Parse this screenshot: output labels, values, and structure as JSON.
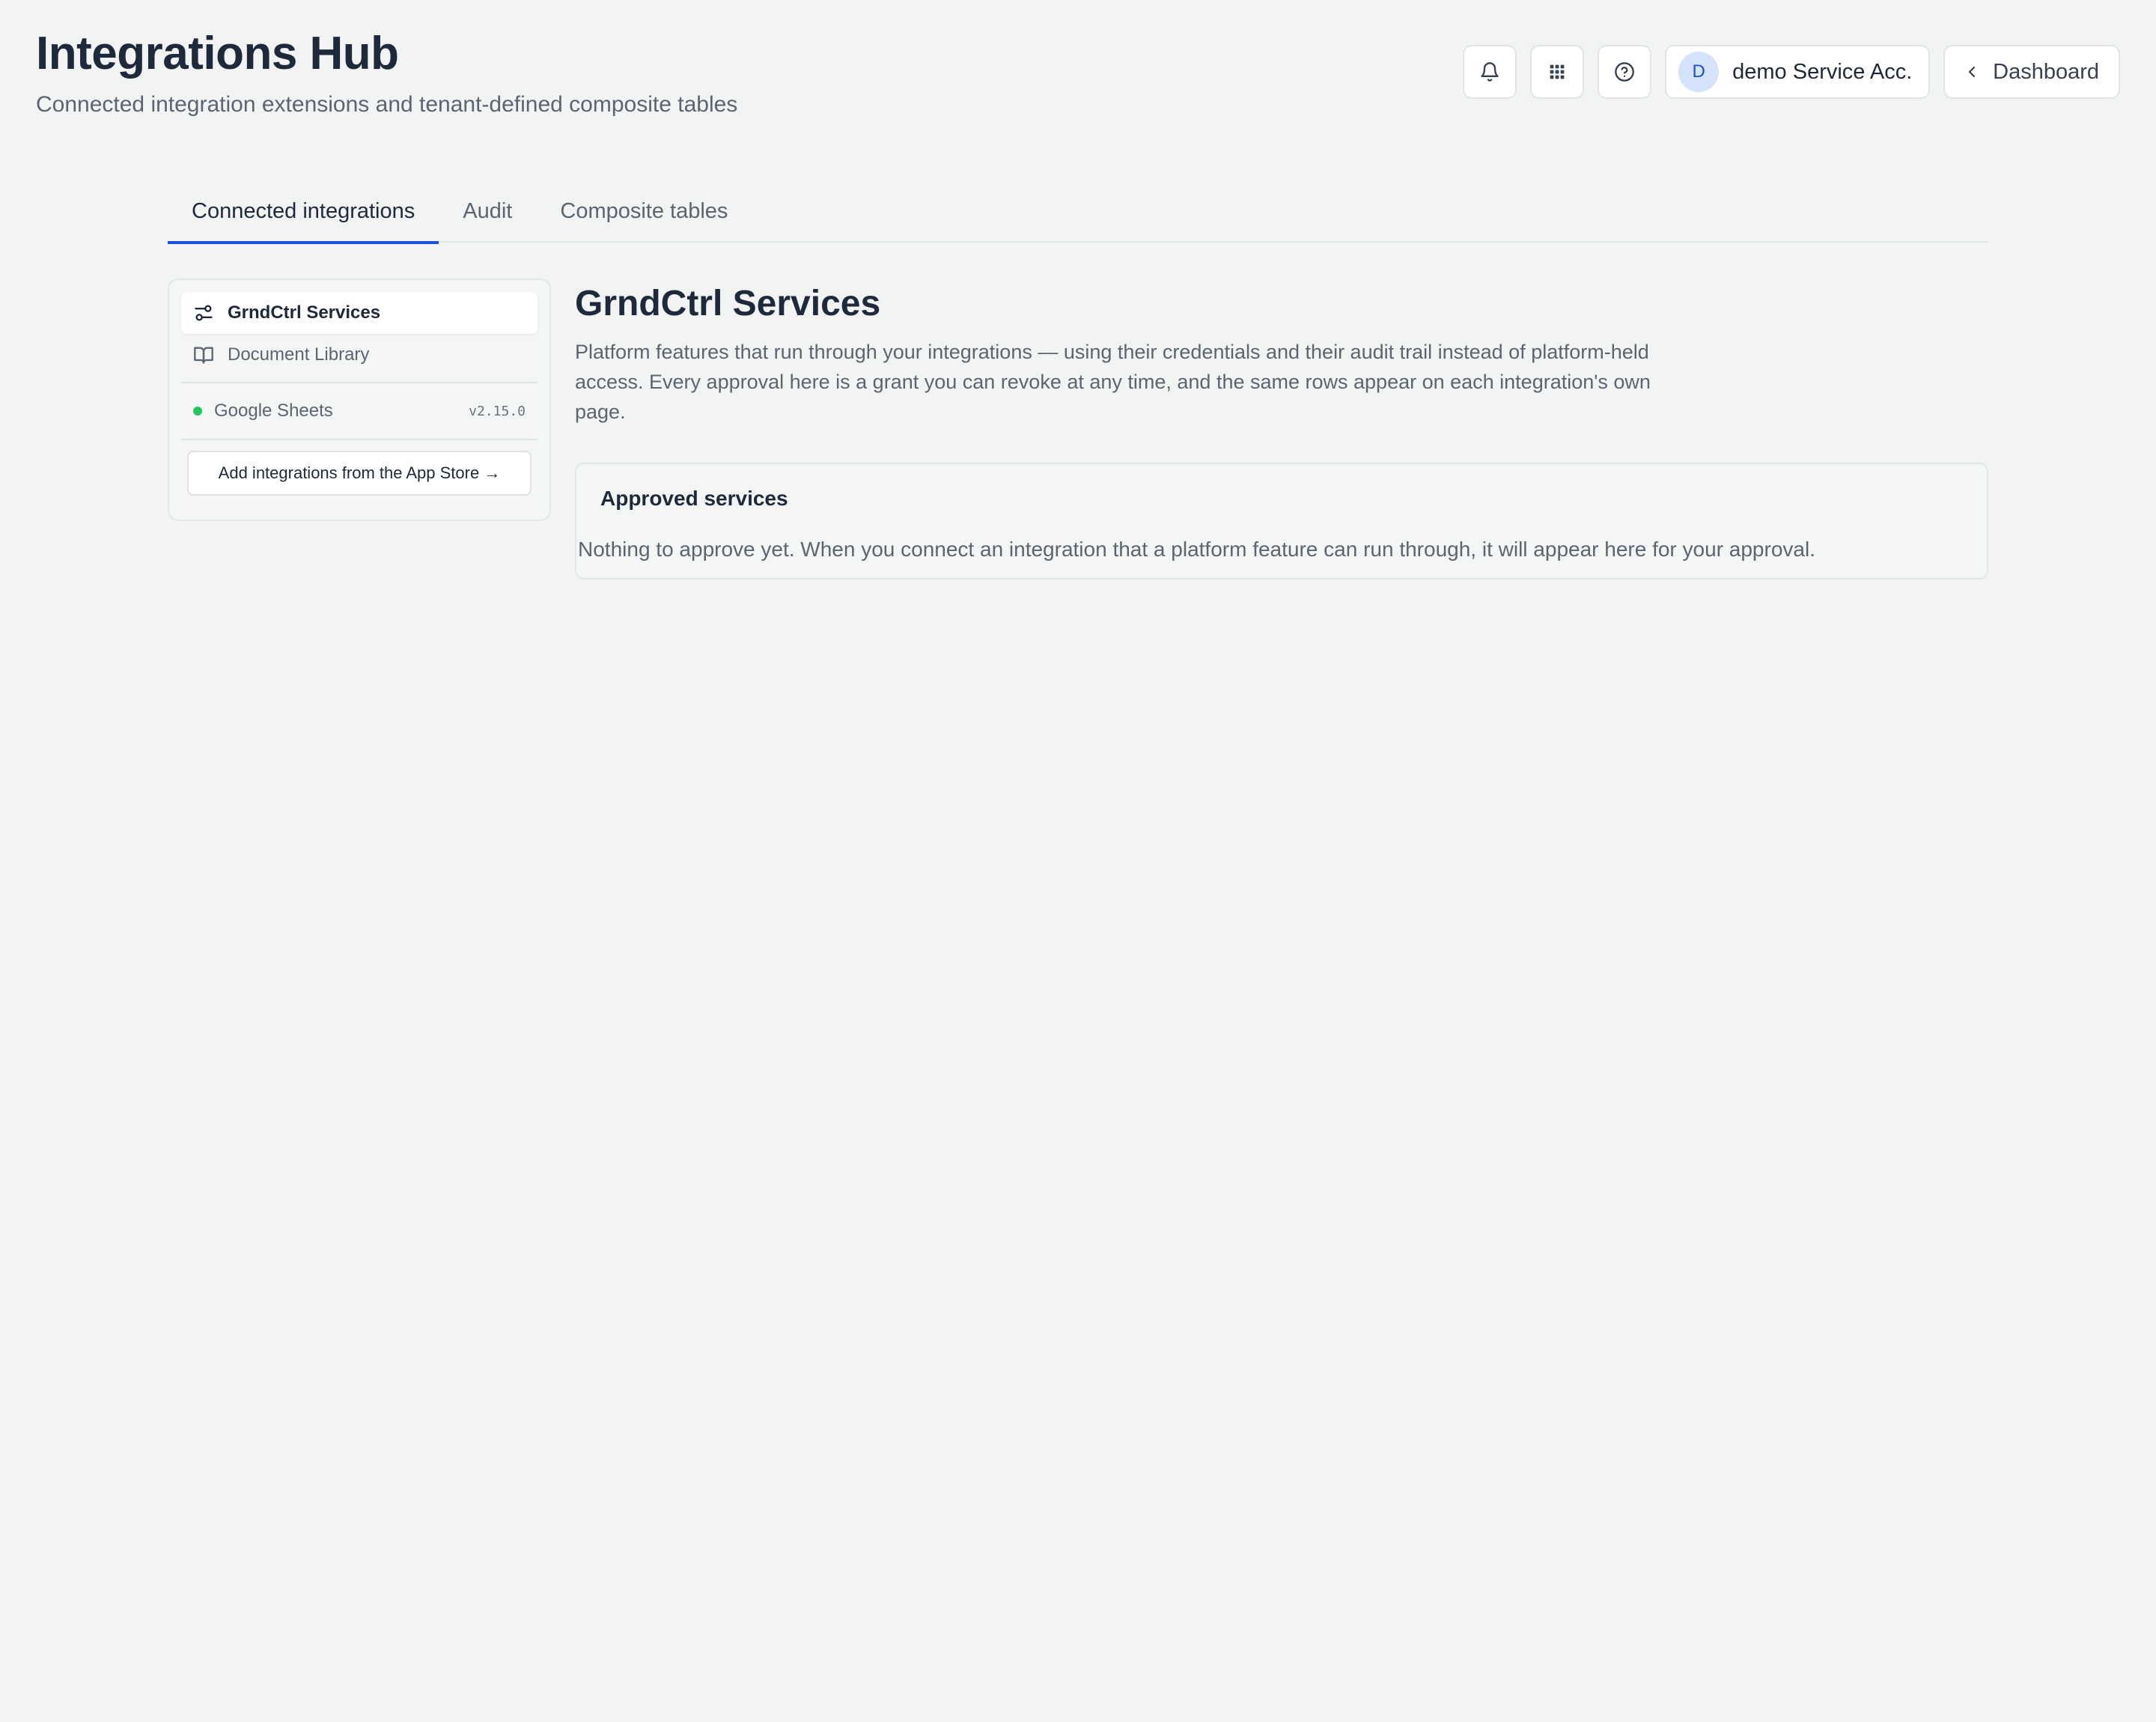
{
  "header": {
    "title": "Integrations Hub",
    "subtitle": "Connected integration extensions and tenant-defined composite tables"
  },
  "topbar": {
    "notifications_icon": "bell-icon",
    "apps_icon": "grid-icon",
    "help_icon": "help-circle-icon",
    "account": {
      "avatar_initial": "D",
      "name": "demo Service Acc..."
    },
    "dashboard_label": "Dashboard"
  },
  "tabs": [
    {
      "label": "Connected integrations",
      "active": true
    },
    {
      "label": "Audit",
      "active": false
    },
    {
      "label": "Composite tables",
      "active": false
    }
  ],
  "sidebar": {
    "items": [
      {
        "label": "GrndCtrl Services",
        "icon": "sliders-icon",
        "active": true
      },
      {
        "label": "Document Library",
        "icon": "book-icon",
        "active": false
      }
    ],
    "integrations": [
      {
        "name": "Google Sheets",
        "version": "v2.15.0",
        "status_color": "#22c55e"
      }
    ],
    "add_label": "Add integrations from the App Store →"
  },
  "main": {
    "title": "GrndCtrl Services",
    "description": "Platform features that run through your integrations — using their credentials and their audit trail instead of platform-held access. Every approval here is a grant you can revoke at any time, and the same rows appear on each integration's own page.",
    "approved": {
      "title": "Approved services",
      "empty_text": "Nothing to approve yet. When you connect an integration that a platform feature can run through, it will appear here for your approval."
    }
  },
  "colors": {
    "accent": "#1d4ed8",
    "background": "#f2f4f3",
    "status_ok": "#22c55e"
  }
}
